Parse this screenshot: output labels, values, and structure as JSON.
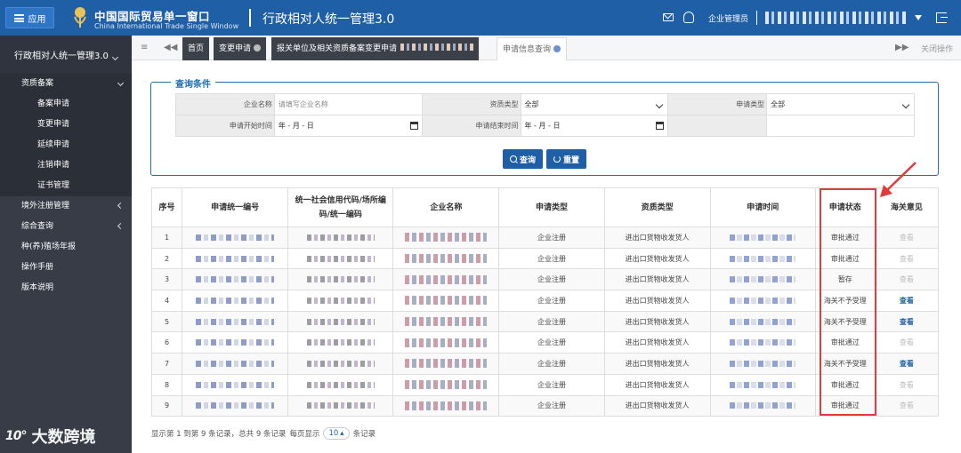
{
  "header": {
    "app_button_label": "应用",
    "brand_cn": "中国国际贸易单一窗口",
    "brand_en": "China International Trade Single Window",
    "system_title": "行政相对人统一管理3.0",
    "user_role": "企业管理员"
  },
  "sidebar": {
    "title": "行政相对人统一管理3.0",
    "groups": [
      {
        "label": "资质备案",
        "expanded": true,
        "items": [
          "备案申请",
          "变更申请",
          "延续申请",
          "注销申请",
          "证书管理"
        ]
      },
      {
        "label": "境外注册管理"
      },
      {
        "label": "综合查询"
      },
      {
        "label": "种(养)殖场年报"
      },
      {
        "label": "操作手册"
      },
      {
        "label": "版本说明"
      }
    ]
  },
  "tabs": {
    "home": "首页",
    "change": "变更申请",
    "filing": "报关单位及相关资质备案变更申请",
    "query": "申请信息查询",
    "close_ops": "关闭操作"
  },
  "query": {
    "legend": "查询条件",
    "enterprise_name_label": "企业名称",
    "enterprise_name_placeholder": "请填写企业名称",
    "qual_type_label": "资质类型",
    "qual_type_value": "全部",
    "apply_type_label": "申请类型",
    "apply_type_value": "全部",
    "start_time_label": "申请开始时间",
    "end_time_label": "申请结束时间",
    "date_placeholder": "年 - 月 - 日",
    "search_btn": "查询",
    "reset_btn": "重置"
  },
  "results": {
    "columns": [
      "序号",
      "申请统一编号",
      "统一社会信用代码/场所编码/统一编码",
      "企业名称",
      "申请类型",
      "资质类型",
      "申请时间",
      "申请状态",
      "海关意见"
    ],
    "view_label": "查看",
    "rows": [
      {
        "no": "1",
        "apply_type": "企业注册",
        "qual_type": "进出口货物收发货人",
        "status": "审批通过",
        "opinion_active": false
      },
      {
        "no": "2",
        "apply_type": "企业注册",
        "qual_type": "进出口货物收发货人",
        "status": "审批通过",
        "opinion_active": false
      },
      {
        "no": "3",
        "apply_type": "企业注册",
        "qual_type": "进出口货物收发货人",
        "status": "暂存",
        "opinion_active": false
      },
      {
        "no": "4",
        "apply_type": "企业注册",
        "qual_type": "进出口货物收发货人",
        "status": "海关不予受理",
        "opinion_active": true
      },
      {
        "no": "5",
        "apply_type": "企业注册",
        "qual_type": "进出口货物收发货人",
        "status": "海关不予受理",
        "opinion_active": true
      },
      {
        "no": "6",
        "apply_type": "企业注册",
        "qual_type": "进出口货物收发货人",
        "status": "审批通过",
        "opinion_active": false
      },
      {
        "no": "7",
        "apply_type": "企业注册",
        "qual_type": "进出口货物收发货人",
        "status": "海关不予受理",
        "opinion_active": true
      },
      {
        "no": "8",
        "apply_type": "企业注册",
        "qual_type": "进出口货物收发货人",
        "status": "审批通过",
        "opinion_active": false
      },
      {
        "no": "9",
        "apply_type": "企业注册",
        "qual_type": "进出口货物收发货人",
        "status": "审批通过",
        "opinion_active": false
      }
    ]
  },
  "pager": {
    "summary": "显示第 1 到第 9 条记录，总共 9 条记录",
    "per_page_label": "每页显示",
    "per_page_value": "10",
    "unit": "条记录"
  },
  "watermark": {
    "logo": "10°",
    "text": "大数跨境"
  },
  "colors": {
    "primary": "#1f5fa5",
    "sidebar": "#373c47",
    "highlight": "#e23b3b"
  }
}
